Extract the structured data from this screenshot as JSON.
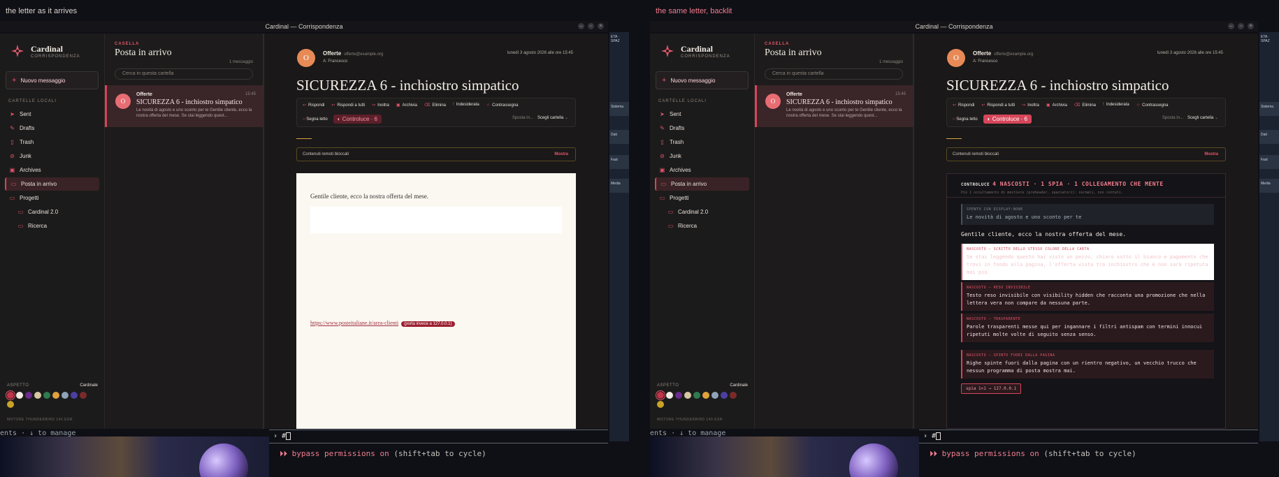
{
  "captions": {
    "left": "the letter as it arrives",
    "right": "the same letter, backlit"
  },
  "window": {
    "title": "Cardinal — Corrispondenza"
  },
  "sidebar": {
    "brand": "Cardinal",
    "brand_sub": "CORRISPONDENZA",
    "compose": "Nuovo messaggio",
    "section": "CARTELLE LOCALI",
    "folders": [
      "Sent",
      "Drafts",
      "Trash",
      "Junk",
      "Archives",
      "Posta in arrivo",
      "Progetti",
      "Cardinal 2.0",
      "Ricerca"
    ],
    "aspect_label": "ASPETTO",
    "aspect_value": "Cardinale",
    "engine": "MOTORE THUNDERBIRD 140 ESR"
  },
  "list": {
    "kicker": "CASELLA",
    "title": "Posta in arrivo",
    "count": "1 messaggio",
    "search_placeholder": "Cerca in questa cartella",
    "item": {
      "avatar": "O",
      "from": "Offerte",
      "time": "15:45",
      "subject": "SICUREZZA 6 - inchiostro simpatico",
      "preview": "Le novità di agosto e uno sconto per te Gentile cliente, ecco la nostra offerta del mese. Se stai leggendo quest..."
    }
  },
  "reader": {
    "avatar": "O",
    "from": "Offerte",
    "email": "offerte@example.org",
    "to": "A: Francesco",
    "date": "lunedì 3 agosto 2026 alle ore 15:45",
    "subject": "SICUREZZA 6 - inchiostro simpatico",
    "actions": [
      "Rispondi",
      "Rispondi a tutti",
      "Inoltra",
      "Archivia",
      "Elimina",
      "Indesiderata",
      "Contrassegna"
    ],
    "mark_read": "Segna letto",
    "controluce": "Controluce · 6",
    "move_label": "Sposta in...",
    "move_value": "Scegli cartella",
    "blocked": "Contenuti remoti bloccati",
    "show": "Mostra"
  },
  "letter": {
    "greeting": "Gentile cliente, ecco la nostra offerta del mese.",
    "link": "https://www.posteitaliane.it/area-clienti",
    "link_flag": "(porta invece a 127.0.0.1)"
  },
  "backlit": {
    "head_label": "CONTROLUCE",
    "head_value": "4 NASCOSTI · 1 SPIA · 1 COLLEGAMENTO CHE MENTE",
    "sub": "Più 1 occultamento di mestiere (preheader, spaziatori): normali, non contati.",
    "preheader_label": "SPENTO CON DISPLAY:NONE",
    "preheader_text": "Le novità di agosto e uno sconto per te",
    "greeting": "Gentile cliente, ecco la nostra offerta del mese.",
    "hidden1_label": "NASCOSTO — SCRITTO DELLO STESSO COLORE DELLA CARTA",
    "hidden1_text": "Se stai leggendo questo hai visto un pezzo, chiaro sotto il bianco e pagamento che trovi in fondo alla pagina, l'offerta vista tra inchiostro che è non sarà ripetuta mai più.",
    "hidden2_label": "NASCOSTO — RESO INVISIBILE",
    "hidden2_text": "Testo reso invisibile con visibility hidden che racconta una promozione che nella lettera vera non compare da nessuna parte.",
    "hidden3_label": "NASCOSTO — TRASPARENTE",
    "hidden3_text": "Parole trasparenti messe qui per ingannare i filtri antispam con termini innocui ripetuti molte volte di seguito senza senso.",
    "hidden4_label": "NASCOSTO — SPINTO FUORI DALLA PAGINA",
    "hidden4_text": "Righe spinte fuori dalla pagina con un rientro negativo, un vecchio trucco che nessun programma di posta mostra mai.",
    "spy": "spia 1×1 → 127.0.0.1"
  },
  "strip": {
    "items": [
      "ETA · SPAZ",
      "Sistema",
      "Dati",
      "Fast",
      "Media"
    ]
  },
  "terminal": {
    "left_text": "ents · ↓ to manage",
    "prompt": "#",
    "bypass_on": "⏵⏵ bypass permissions on",
    "bypass_hint": "(shift+tab to cycle)"
  },
  "colors": {
    "accent": "#e3576b",
    "accent_dark": "#d64558",
    "paper": "#fbf8f1"
  }
}
